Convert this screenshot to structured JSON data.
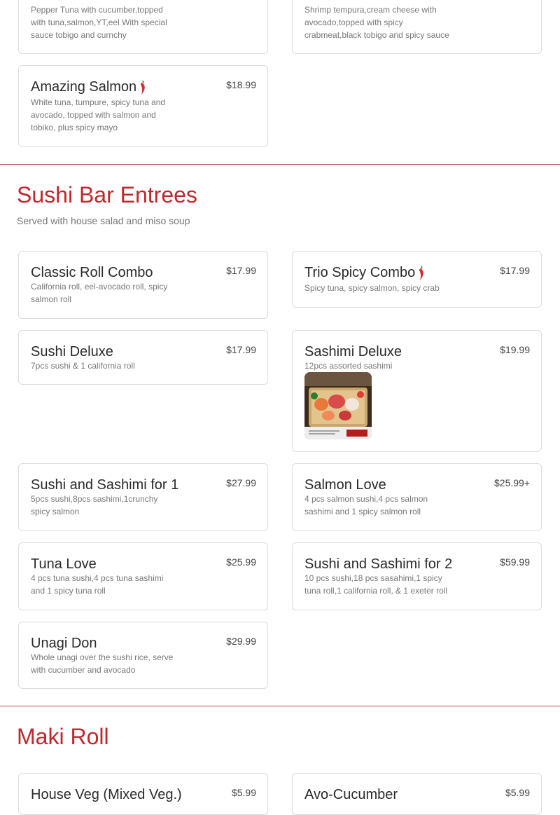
{
  "top_items": [
    {
      "desc": "Pepper Tuna with cucumber,topped with tuna,salmon,YT,eel With special sauce tobigo and curnchy"
    },
    {
      "desc": "Shrimp tempura,cream cheese with avocado,topped with spicy crabmeat,black tobigo and spicy sauce"
    }
  ],
  "amazing_salmon": {
    "name": "Amazing Salmon",
    "price": "$18.99",
    "desc": "White tuna, tumpure, spicy tuna and avocado, topped with salmon and tobiko, plus spicy mayo"
  },
  "sushi_bar": {
    "title": "Sushi Bar Entrees",
    "subtitle": "Served with house salad and miso soup",
    "items": [
      {
        "name": "Classic Roll Combo",
        "price": "$17.99",
        "desc": "California roll, eel-avocado roll, spicy salmon roll"
      },
      {
        "name": "Trio Spicy Combo",
        "price": "$17.99",
        "desc": "Spicy tuna, spicy salmon, spicy crab"
      },
      {
        "name": "Sushi Deluxe",
        "price": "$17.99",
        "desc": "7pcs sushi & 1 california roll"
      },
      {
        "name": "Sashimi Deluxe",
        "price": "$19.99",
        "desc": "12pcs assorted sashimi"
      },
      {
        "name": "Sushi and Sashimi for 1",
        "price": "$27.99",
        "desc": "5pcs sushi,8pcs sashimi,1crunchy spicy salmon"
      },
      {
        "name": "Salmon Love",
        "price": "$25.99+",
        "desc": "4 pcs salmon sushi,4 pcs salmon sashimi and 1 spicy salmon roll"
      },
      {
        "name": "Tuna Love",
        "price": "$25.99",
        "desc": "4 pcs tuna sushi,4 pcs tuna sashimi and 1 spicy tuna roll"
      },
      {
        "name": "Sushi and Sashimi for 2",
        "price": "$59.99",
        "desc": "10 pcs sushi,18 pcs sasahimi,1 spicy tuna roll,1 california roll, & 1 exeter roll"
      },
      {
        "name": "Unagi Don",
        "price": "$29.99",
        "desc": "Whole unagi over the sushi rice, serve with cucumber and avocado"
      }
    ]
  },
  "maki": {
    "title": "Maki Roll",
    "items": [
      {
        "name": "House Veg (Mixed Veg.)",
        "price": "$5.99"
      },
      {
        "name": "Avo-Cucumber",
        "price": "$5.99"
      }
    ]
  },
  "icons": {
    "spicy": "chili-pepper-icon"
  },
  "colors": {
    "accent": "#c0272d",
    "pepper": "#d32f2f"
  }
}
